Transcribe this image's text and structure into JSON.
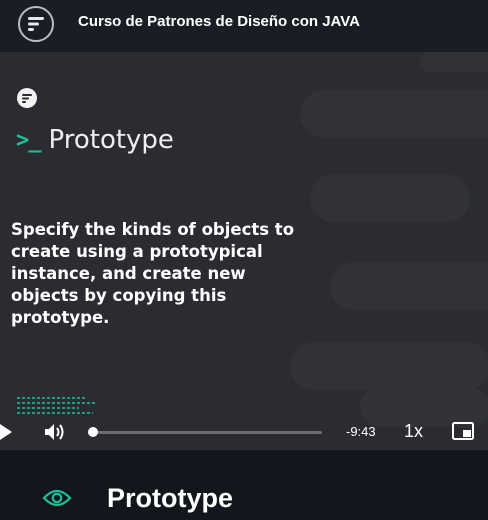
{
  "header": {
    "course_title": "Curso de Patrones de Diseño con JAVA",
    "logo_icon": "platzi-logo-icon"
  },
  "video": {
    "slide": {
      "heading_prompt": ">_",
      "heading": "Prototype",
      "description": "Specify the kinds of objects to create using a prototypical instance, and create new objects by copying this prototype."
    },
    "player": {
      "time_remaining": "-9:43",
      "speed": "1x",
      "progress": 0.0
    },
    "colors": {
      "accent": "#1fbf9a",
      "background": "#2a2c31"
    }
  },
  "lesson": {
    "title": "Prototype",
    "icon": "eye-icon"
  }
}
